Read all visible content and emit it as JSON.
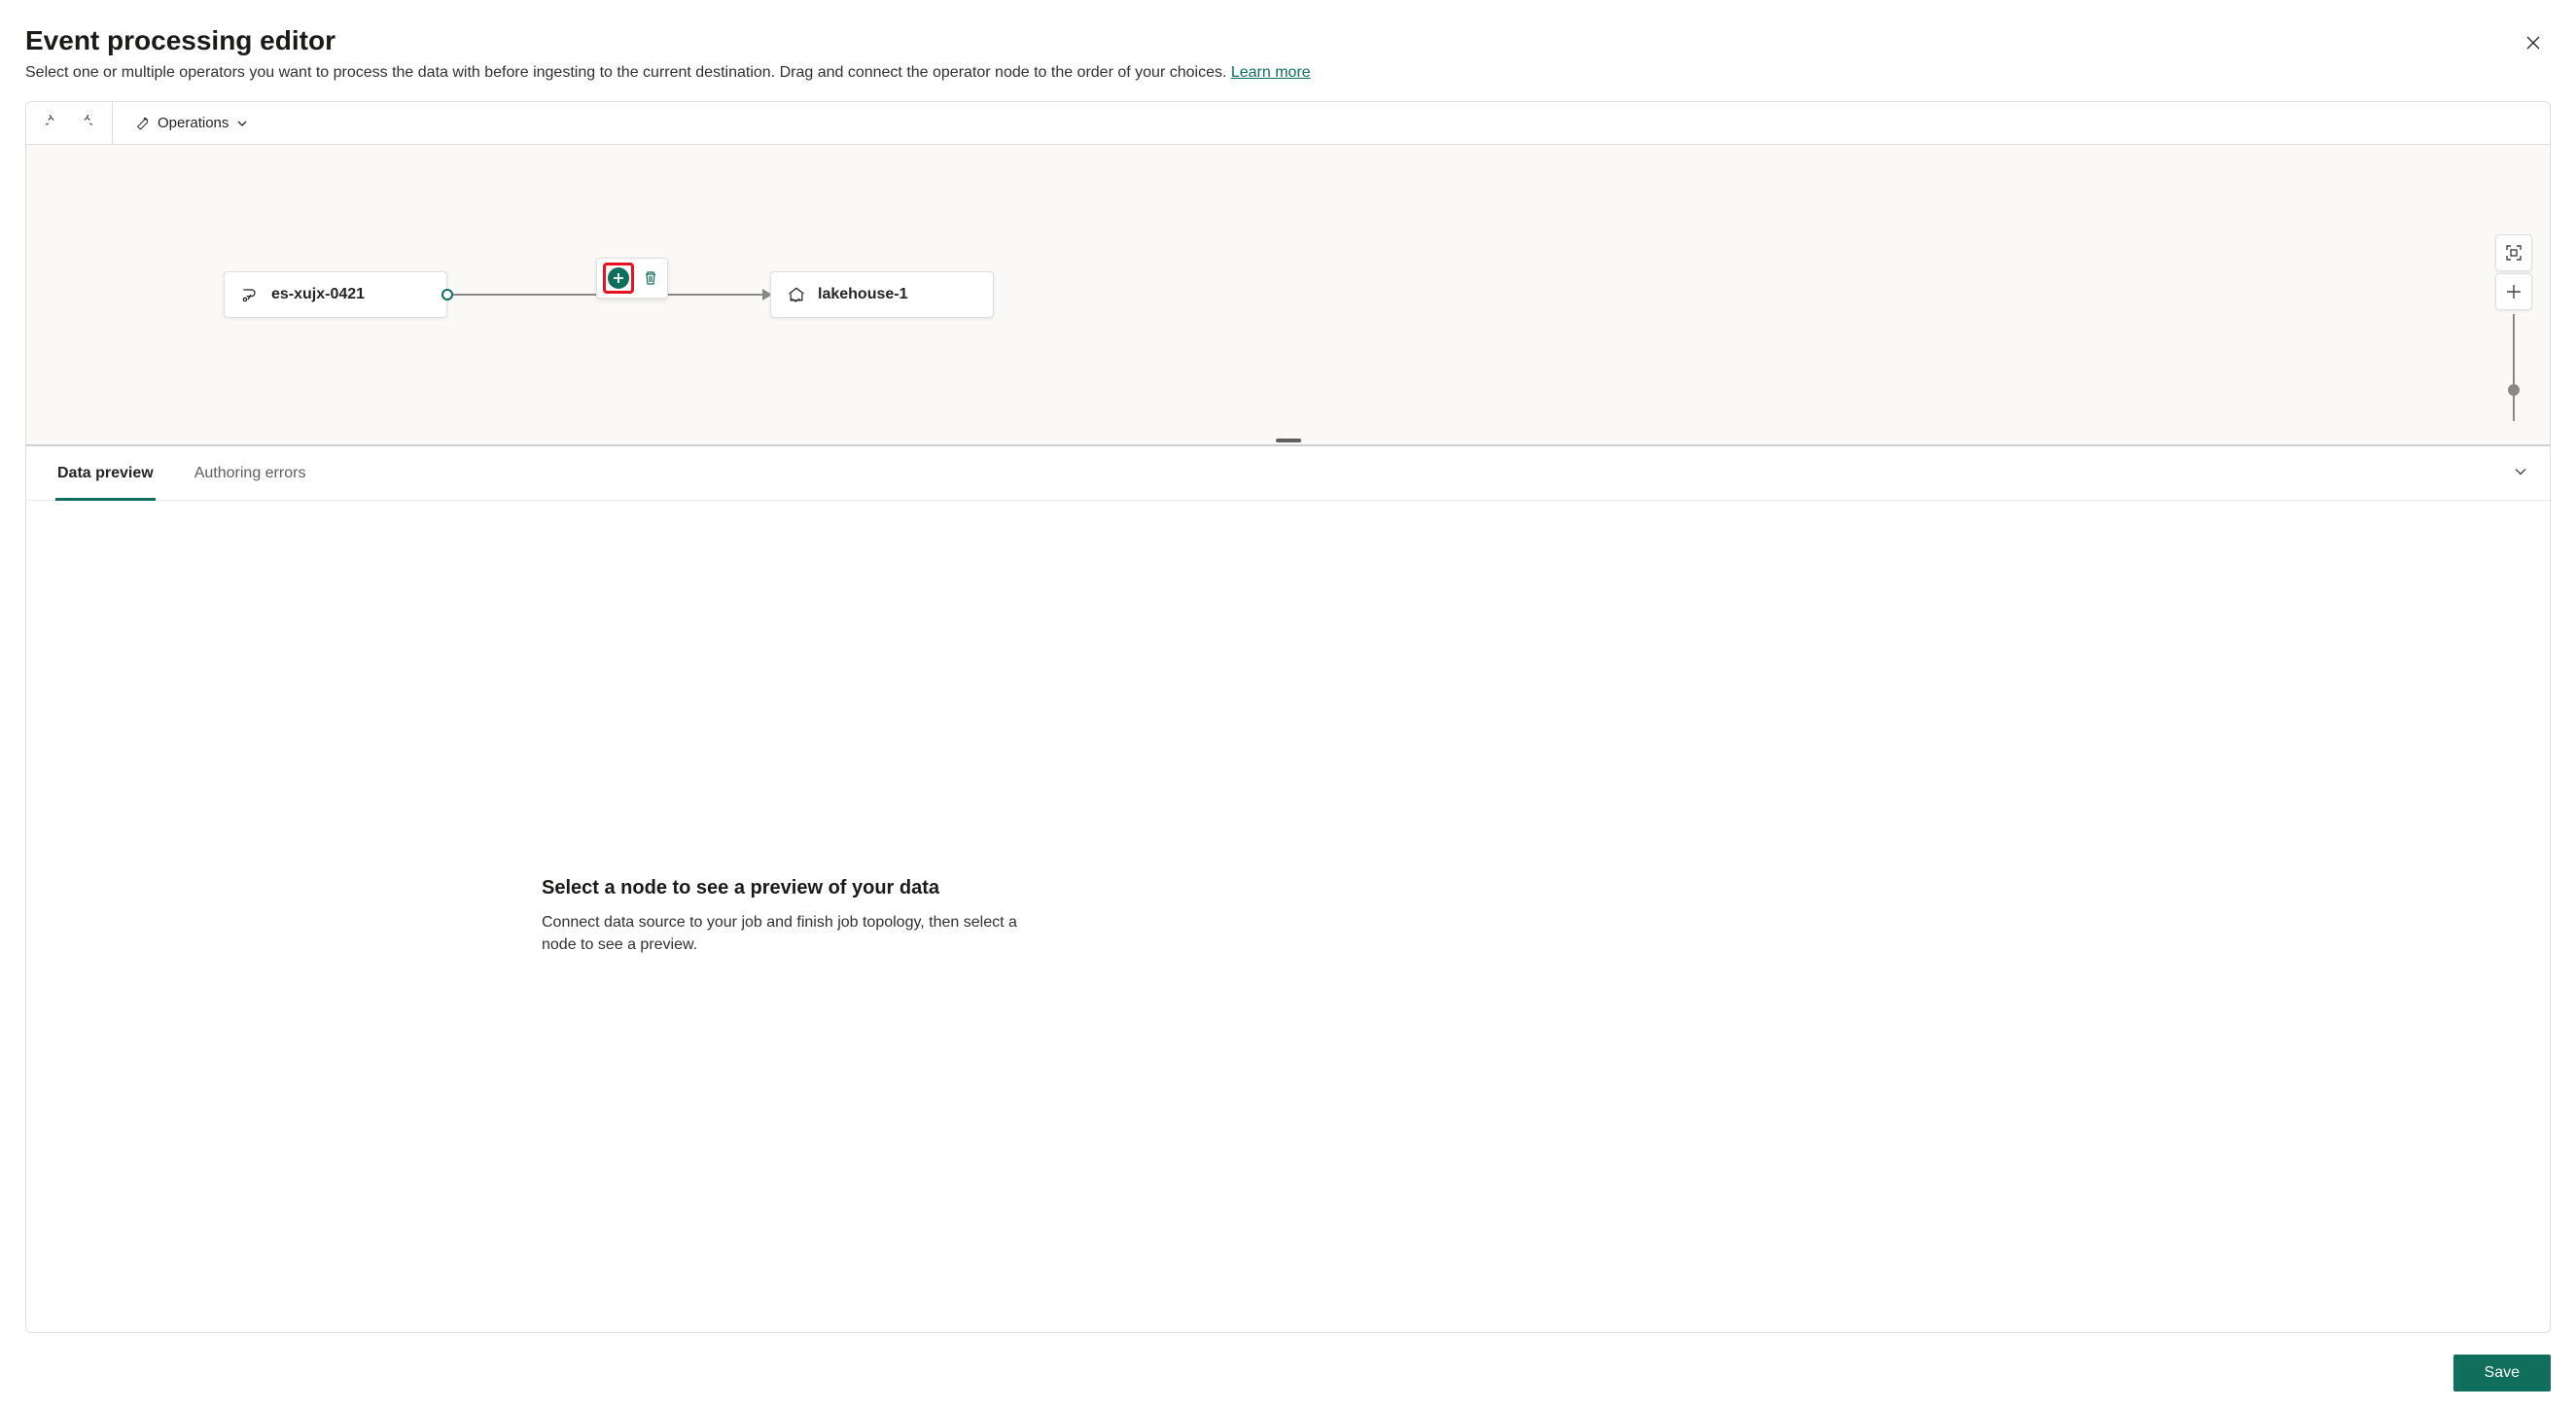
{
  "header": {
    "title": "Event processing editor",
    "subtitle": "Select one or multiple operators you want to process the data with before ingesting to the current destination. Drag and connect the operator node to the order of your choices. ",
    "learn_more": "Learn more"
  },
  "toolbar": {
    "operations_label": "Operations"
  },
  "nodes": {
    "source_label": "es-xujx-0421",
    "dest_label": "lakehouse-1"
  },
  "tabs": {
    "data_preview": "Data preview",
    "authoring_errors": "Authoring errors"
  },
  "preview": {
    "title": "Select a node to see a preview of your data",
    "desc": "Connect data source to your job and finish job topology, then select a node to see a preview."
  },
  "footer": {
    "save_label": "Save"
  }
}
